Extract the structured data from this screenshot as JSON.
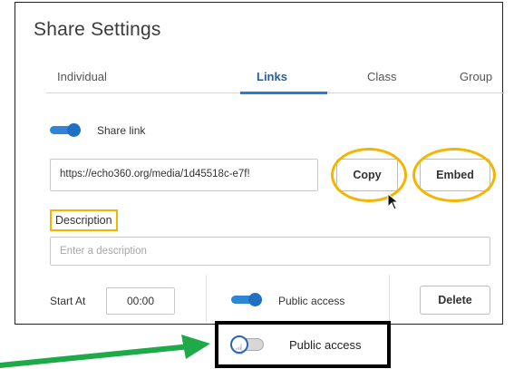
{
  "dialog": {
    "title": "Share Settings"
  },
  "tabs": [
    {
      "label": "Individual",
      "active": false
    },
    {
      "label": "Links",
      "active": true
    },
    {
      "label": "Class",
      "active": false
    },
    {
      "label": "Group",
      "active": false
    }
  ],
  "share_link": {
    "label": "Share link",
    "enabled": true
  },
  "link": {
    "url": "https://echo360.org/media/1d45518c-e7f!",
    "copy_label": "Copy",
    "embed_label": "Embed"
  },
  "description": {
    "label": "Description",
    "placeholder": "Enter a description",
    "value": ""
  },
  "start_at": {
    "label": "Start At",
    "value": "00:00"
  },
  "public_access": {
    "label": "Public access",
    "enabled": true
  },
  "delete_label": "Delete",
  "callout": {
    "label": "Public access",
    "toggle_enabled": false
  },
  "colors": {
    "accent_blue": "#2f86d6",
    "highlight_yellow": "#f4b400",
    "arrow_green": "#1faa4a"
  },
  "icons": {
    "cursor": "mouse-pointer-icon",
    "hand": "hand-pointer-icon",
    "arrow": "green-arrow-icon"
  }
}
